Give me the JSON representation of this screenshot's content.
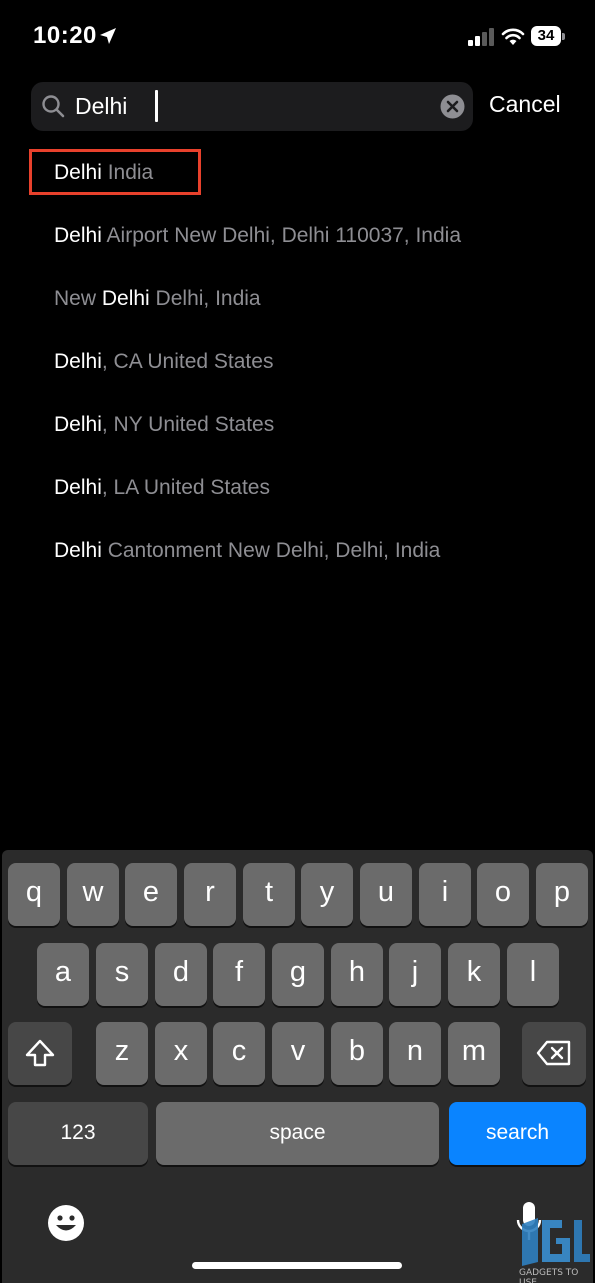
{
  "status_bar": {
    "time": "10:20",
    "battery": "34"
  },
  "search": {
    "query": "Delhi",
    "cancel_label": "Cancel"
  },
  "results": [
    {
      "match": "Delhi",
      "rest": " India",
      "highlighted": true
    },
    {
      "match": "Delhi",
      "rest": " Airport New Delhi, Delhi 110037, India"
    },
    {
      "prefix": "New ",
      "match": "Delhi",
      "rest": " Delhi, India"
    },
    {
      "match": "Delhi",
      "rest": ", CA United States"
    },
    {
      "match": "Delhi",
      "rest": ", NY United States"
    },
    {
      "match": "Delhi",
      "rest": ", LA United States"
    },
    {
      "match": "Delhi",
      "rest": " Cantonment New Delhi, Delhi, India"
    }
  ],
  "keyboard": {
    "row1": [
      "q",
      "w",
      "e",
      "r",
      "t",
      "y",
      "u",
      "i",
      "o",
      "p"
    ],
    "row2": [
      "a",
      "s",
      "d",
      "f",
      "g",
      "h",
      "j",
      "k",
      "l"
    ],
    "row3": [
      "z",
      "x",
      "c",
      "v",
      "b",
      "n",
      "m"
    ],
    "numbers_label": "123",
    "space_label": "space",
    "search_label": "search",
    "accent_color": "#0a84ff"
  },
  "highlight_color": "#e8412c",
  "watermark_text": "GADGETS TO USE"
}
